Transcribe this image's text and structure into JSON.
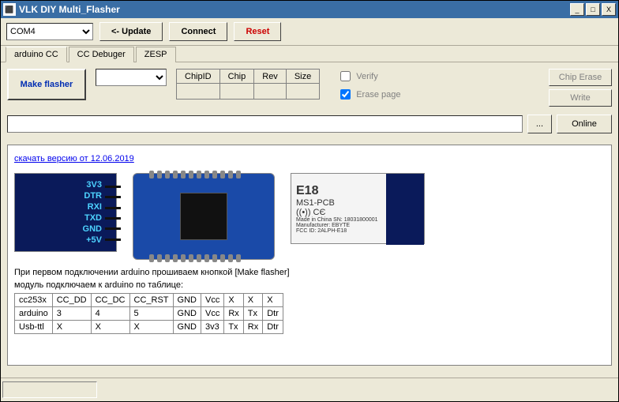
{
  "window": {
    "title": "VLK DIY Multi_Flasher"
  },
  "toolbar": {
    "port_selected": "COM4",
    "update_label": "<-  Update",
    "connect_label": "Connect",
    "reset_label": "Reset"
  },
  "tabs": [
    {
      "label": "arduino CC",
      "active": true
    },
    {
      "label": "CC Debuger",
      "active": false
    },
    {
      "label": "ZESP",
      "active": false
    }
  ],
  "action_panel": {
    "make_flasher_label": "Make flasher",
    "spec_headers": [
      "ChipID",
      "Chip",
      "Rev",
      "Size"
    ],
    "verify_label": "Verify",
    "verify_checked": false,
    "erase_label": "Erase page",
    "erase_checked": true,
    "chip_erase_label": "Chip Erase",
    "write_label": "Write"
  },
  "path_row": {
    "path_value": "",
    "browse_label": "...",
    "online_label": "Online"
  },
  "content": {
    "link_text": "скачать версию от 12.06.2019",
    "board1_labels": [
      "3V3",
      "DTR",
      "RXI",
      "TXD",
      "GND",
      "+5V"
    ],
    "board3_title": "E18",
    "board3_sub": "MS1-PCB",
    "board3_cert": "((•)) CЄ",
    "board3_made": "Made in China    SN: 18031800001",
    "board3_mfr": "Manufacturer: EBYTE",
    "board3_fcc": "FCC ID: 2ALPH-E18",
    "instruction1": "При первом подключении arduino прошиваем кнопкой [Make flasher]",
    "instruction2": "модуль подключаем к arduino по таблице:",
    "pin_table": [
      [
        "cc253x",
        "CC_DD",
        "CC_DC",
        "CC_RST",
        "GND",
        "Vcc",
        "X",
        "X",
        "X"
      ],
      [
        "arduino",
        "3",
        "4",
        "5",
        "GND",
        "Vcc",
        "Rx",
        "Tx",
        "Dtr"
      ],
      [
        "Usb-ttl",
        "X",
        "X",
        "X",
        "GND",
        "3v3",
        "Tx",
        "Rx",
        "Dtr"
      ]
    ]
  }
}
